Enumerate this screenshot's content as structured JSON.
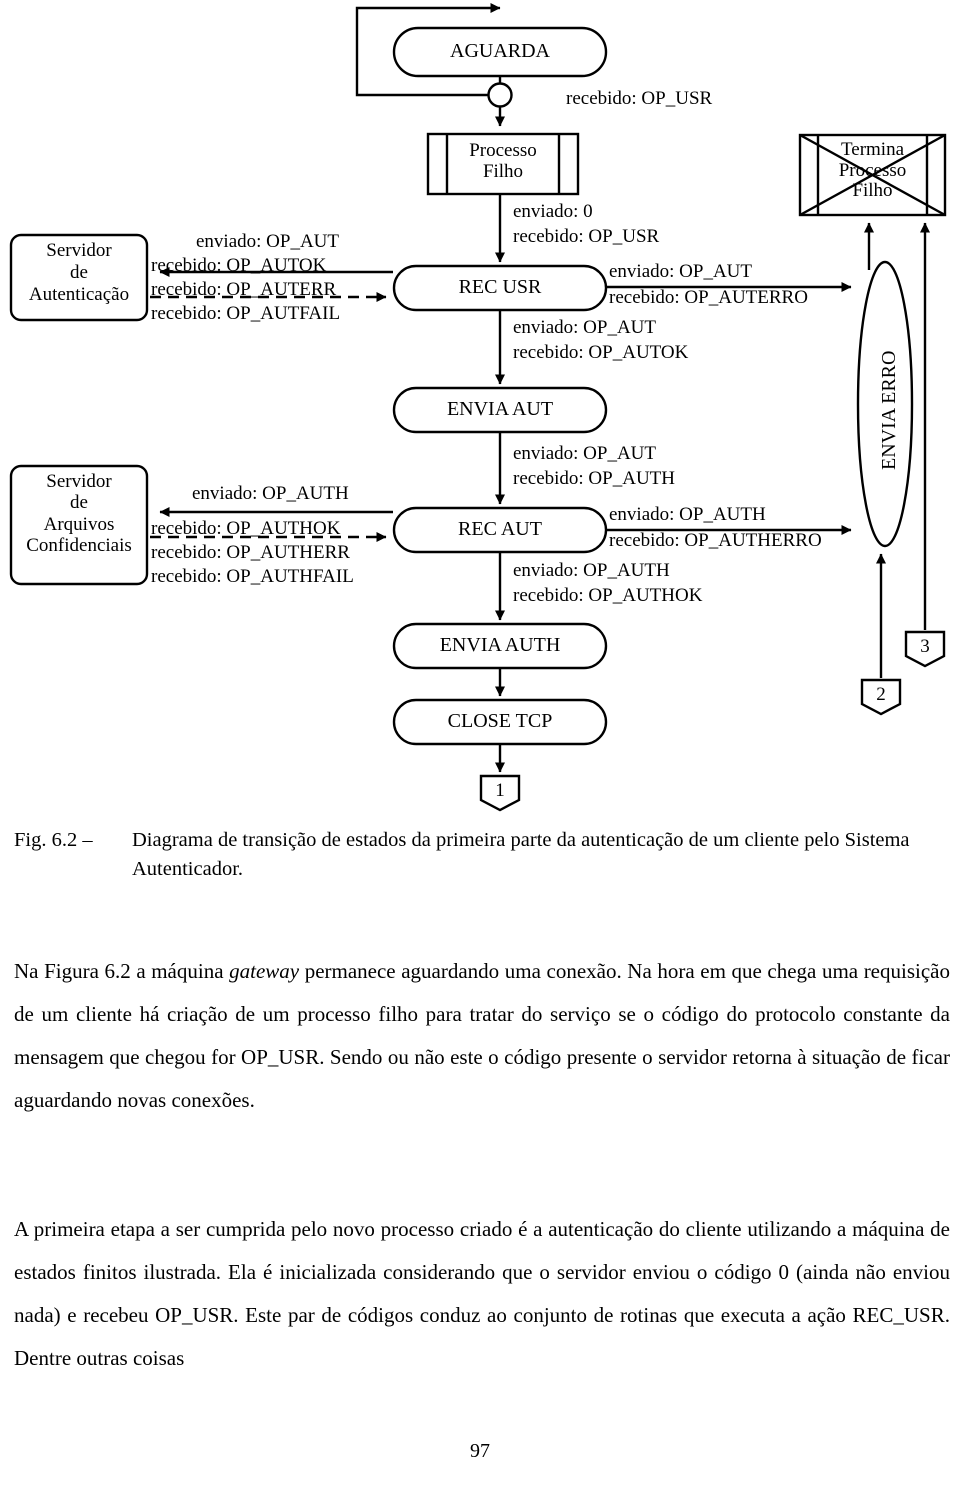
{
  "figure": {
    "states": [
      {
        "id": "aguarda",
        "label": "AGUARDA"
      },
      {
        "id": "rec-usr",
        "label": "REC USR"
      },
      {
        "id": "envia-aut",
        "label": "ENVIA AUT"
      },
      {
        "id": "rec-aut",
        "label": "REC AUT"
      },
      {
        "id": "envia-auth",
        "label": "ENVIA AUTH"
      },
      {
        "id": "close-tcp",
        "label": "CLOSE TCP"
      },
      {
        "id": "envia-erro",
        "label": "ENVIA ERRO"
      }
    ],
    "process_boxes": [
      {
        "id": "processo-filho",
        "line1": "Processo",
        "line2": "Filho"
      },
      {
        "id": "termina-processo-filho",
        "line1": "Termina",
        "line2": "Processo",
        "line3": "Filho"
      }
    ],
    "external_boxes": [
      {
        "id": "servidor-autenticacao",
        "lines": [
          "Servidor",
          "de",
          "Autenticação"
        ],
        "out_label": "enviado: OP_AUT",
        "in_labels": [
          "recebido: OP_AUTOK",
          "recebido: OP_AUTERR",
          "recebido: OP_AUTFAIL"
        ]
      },
      {
        "id": "servidor-arquivos-confidenciais",
        "lines": [
          "Servidor",
          "de",
          "Arquivos",
          "Confidenciais"
        ],
        "out_label": "enviado: OP_AUTH",
        "in_labels": [
          "recebido: OP_AUTHOK",
          "recebido: OP_AUTHERR",
          "recebido: OP_AUTHFAIL"
        ]
      }
    ],
    "transitions": [
      {
        "id": "t-aguarda-filho",
        "lines": [
          "recebido: OP_USR"
        ]
      },
      {
        "id": "t-filho-recusr",
        "lines": [
          "enviado: 0",
          "recebido: OP_USR"
        ]
      },
      {
        "id": "t-recusr-erro",
        "lines": [
          "enviado: OP_AUT",
          "recebido: OP_AUTERRO"
        ]
      },
      {
        "id": "t-recusr-enviaaut",
        "lines": [
          "enviado: OP_AUT",
          "recebido: OP_AUTOK"
        ]
      },
      {
        "id": "t-enviaaut-recaut",
        "lines": [
          "enviado: OP_AUT",
          "recebido: OP_AUTH"
        ]
      },
      {
        "id": "t-recaut-erro",
        "lines": [
          "enviado: OP_AUTH",
          "recebido: OP_AUTHERRO"
        ]
      },
      {
        "id": "t-recaut-enviaauth",
        "lines": [
          "enviado: OP_AUTH",
          "recebido: OP_AUTHOK"
        ]
      }
    ],
    "connectors": [
      {
        "id": "connector-1",
        "label": "1"
      },
      {
        "id": "connector-2",
        "label": "2"
      },
      {
        "id": "connector-3",
        "label": "3"
      }
    ]
  },
  "caption": {
    "tag": "Fig. 6.2 –",
    "text": "Diagrama de transição de estados da primeira parte da autenticação de um cliente pelo Sistema Autenticador."
  },
  "body": {
    "p1_a": "Na Figura 6.2 a máquina ",
    "p1_em": "gateway",
    "p1_b": " permanece aguardando uma conexão. Na hora em que chega uma requisição de um cliente há criação de um processo filho para tratar do serviço se o código do protocolo constante da mensagem que chegou for OP_USR. Sendo ou não este o código presente o servidor retorna à situação de ficar aguardando novas conexões.",
    "p2": "A primeira etapa a ser cumprida pelo novo processo criado é a autenticação do cliente utilizando a máquina de estados finitos ilustrada. Ela é inicializada considerando que o servidor enviou o código 0 (ainda não enviou nada) e recebeu OP_USR. Este par de códigos conduz ao conjunto de rotinas que executa a ação REC_USR. Dentre outras coisas"
  },
  "page_number": "97"
}
